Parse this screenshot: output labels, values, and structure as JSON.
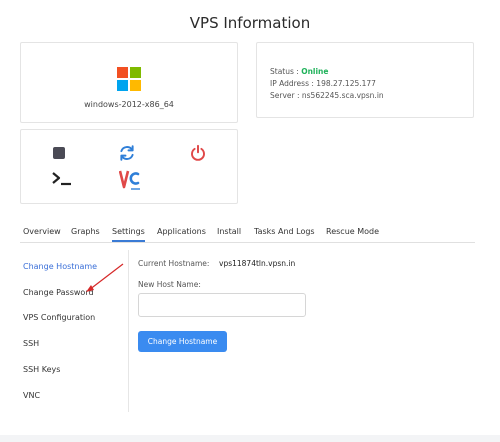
{
  "page": {
    "title": "VPS Information"
  },
  "os": {
    "name": "windows-2012-x86_64",
    "logo_icon": "windows-logo-icon"
  },
  "status": {
    "status_label": "Status : ",
    "status_value": "Online",
    "ip_label": "IP Address : ",
    "ip_value": "198.27.125.177",
    "server_label": "Server : ",
    "server_value": "ns562245.sca.vpsn.in",
    "online_color": "#1fb25a"
  },
  "actions": {
    "stop_icon": "stop-icon",
    "restart_icon": "refresh-icon",
    "power_icon": "power-icon",
    "console_icon": "terminal-icon",
    "vnc_icon": "vnc-icon"
  },
  "tabs": [
    {
      "label": "Overview"
    },
    {
      "label": "Graphs"
    },
    {
      "label": "Settings",
      "active": true
    },
    {
      "label": "Applications"
    },
    {
      "label": "Install"
    },
    {
      "label": "Tasks And Logs"
    },
    {
      "label": "Rescue Mode"
    }
  ],
  "sidebar": {
    "items": [
      {
        "label": "Change Hostname",
        "active": true
      },
      {
        "label": "Change Password"
      },
      {
        "label": "VPS Configuration"
      },
      {
        "label": "SSH"
      },
      {
        "label": "SSH Keys"
      },
      {
        "label": "VNC"
      }
    ]
  },
  "hostname_form": {
    "current_label": "Current Hostname:",
    "current_value": "vps11874tln.vpsn.in",
    "new_label": "New Host Name:",
    "new_value": "",
    "submit_label": "Change Hostname"
  },
  "colors": {
    "accent": "#3a8bf0",
    "active_link": "#3a6fd8",
    "danger": "#e04848"
  }
}
